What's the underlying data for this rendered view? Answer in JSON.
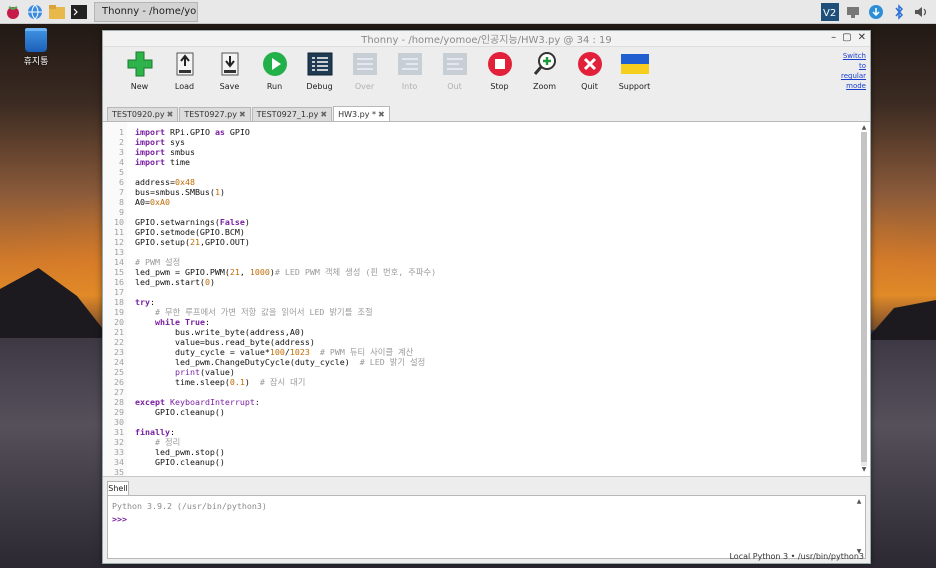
{
  "taskbar": {
    "menu_icon": "raspberry-icon",
    "task_label": "Thonny  -  /home/yo...",
    "right_icons": [
      "vnc-icon",
      "network-icon",
      "update-icon",
      "bluetooth-icon",
      "volume-icon"
    ]
  },
  "desktop": {
    "trash_label": "휴지통"
  },
  "window": {
    "title": "Thonny  -  /home/yomoe/인공지능/HW3.py  @  34 : 19",
    "switch_mode": "Switch to regular mode"
  },
  "toolbar": {
    "items": [
      {
        "label": "New",
        "icon": "new-icon",
        "enabled": true
      },
      {
        "label": "Load",
        "icon": "load-icon",
        "enabled": true
      },
      {
        "label": "Save",
        "icon": "save-icon",
        "enabled": true
      },
      {
        "label": "Run",
        "icon": "run-icon",
        "enabled": true
      },
      {
        "label": "Debug",
        "icon": "debug-icon",
        "enabled": true
      },
      {
        "label": "Over",
        "icon": "step-over-icon",
        "enabled": false
      },
      {
        "label": "Into",
        "icon": "step-into-icon",
        "enabled": false
      },
      {
        "label": "Out",
        "icon": "step-out-icon",
        "enabled": false
      },
      {
        "label": "Stop",
        "icon": "stop-icon",
        "enabled": true
      },
      {
        "label": "Zoom",
        "icon": "zoom-icon",
        "enabled": true
      },
      {
        "label": "Quit",
        "icon": "quit-icon",
        "enabled": true
      },
      {
        "label": "Support",
        "icon": "ukraine-flag-icon",
        "enabled": true
      }
    ]
  },
  "tabs": [
    {
      "label": "TEST0920.py",
      "active": false
    },
    {
      "label": "TEST0927.py",
      "active": false
    },
    {
      "label": "TEST0927_1.py",
      "active": false
    },
    {
      "label": "HW3.py *",
      "active": true
    }
  ],
  "editor": {
    "line_numbers": [
      "1",
      "2",
      "3",
      "4",
      "5",
      "6",
      "7",
      "8",
      "9",
      "10",
      "11",
      "12",
      "13",
      "14",
      "15",
      "16",
      "17",
      "18",
      "19",
      "20",
      "21",
      "22",
      "23",
      "24",
      "25",
      "26",
      "27",
      "28",
      "29",
      "30",
      "31",
      "32",
      "33",
      "34",
      "35"
    ]
  },
  "shell": {
    "tab_label": "Shell",
    "banner": "Python 3.9.2 (/usr/bin/python3)",
    "prompt": ">>>"
  },
  "statusbar": {
    "text": "Local Python 3  •  /usr/bin/python3"
  },
  "colors": {
    "keyword": "#7a1fa2",
    "number": "#c26b06",
    "comment": "#9a9a9a",
    "link": "#1a3fcc"
  }
}
